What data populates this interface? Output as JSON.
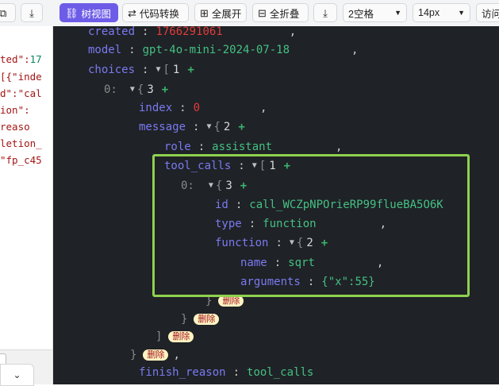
{
  "toolbar": {
    "tree_view": "树视图",
    "code_convert": "代码转换",
    "expand_all": "全展开",
    "collapse_all": "全折叠",
    "indent": "2空格",
    "font_size": "14px",
    "visit": "访问"
  },
  "left_panel": {
    "lines": [
      {
        "a": "ted\":",
        "b": "17"
      },
      {
        "a": "[{\"inde",
        "b": ""
      },
      {
        "a": "d\":\"cal",
        "b": ""
      },
      {
        "a": "ion\":",
        "b": ""
      },
      {
        "a": "reaso",
        "b": ""
      },
      {
        "a": "letion_",
        "b": ""
      },
      {
        "a": "\"fp_c45",
        "b": ""
      }
    ]
  },
  "tree": {
    "created": {
      "key": "created",
      "value": "1766291061"
    },
    "model": {
      "key": "model",
      "value": "gpt-4o-mini-2024-07-18"
    },
    "choices": {
      "key": "choices",
      "count": "1"
    },
    "choice0": {
      "key": "0:",
      "count": "3"
    },
    "index": {
      "key": "index",
      "value": "0"
    },
    "message": {
      "key": "message",
      "count": "2"
    },
    "role": {
      "key": "role",
      "value": "assistant"
    },
    "tool_calls": {
      "key": "tool_calls",
      "count": "1"
    },
    "call0": {
      "key": "0:",
      "count": "3"
    },
    "id": {
      "key": "id",
      "value": "call_WCZpNPOrieRP99flueBA5O6K"
    },
    "type": {
      "key": "type",
      "value": "function"
    },
    "function": {
      "key": "function",
      "count": "2"
    },
    "name": {
      "key": "name",
      "value": "sqrt"
    },
    "arguments": {
      "key": "arguments",
      "value": "{\"x\":55}"
    },
    "finish_reason": {
      "key": "finish_reason",
      "value": "tool_calls"
    },
    "delete_label": "删除"
  },
  "colors": {
    "accent": "#6d5ce8",
    "highlight_border": "#8fd14f",
    "key": "#7a7af0",
    "string": "#45c084",
    "number": "#e23b3b"
  }
}
